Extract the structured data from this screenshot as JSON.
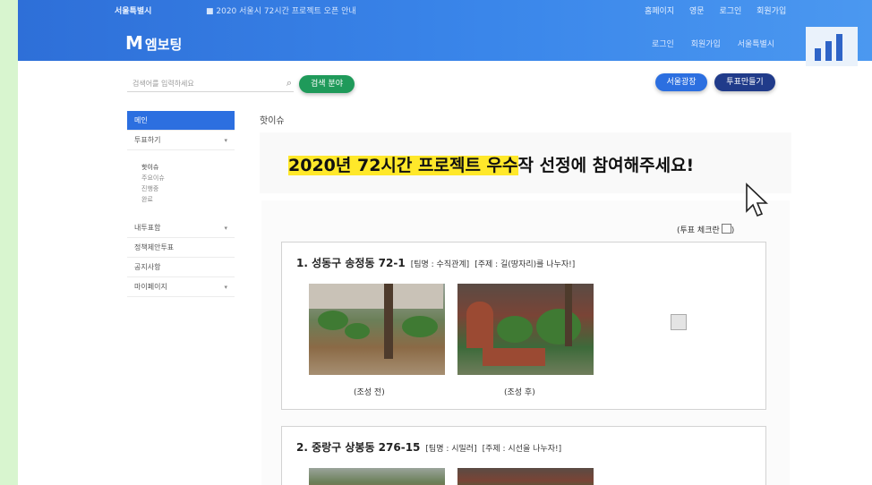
{
  "topbar": {
    "org": "서울특별시",
    "notice": "■ 2020 서울시 72시간 프로젝트 오픈 안내",
    "links": [
      "홈페이지",
      "영문",
      "로그인",
      "회원가입"
    ]
  },
  "header": {
    "logo_letter": "M",
    "logo_text": "엠보팅",
    "links": [
      "로그인",
      "회원가입",
      "서울특별시"
    ]
  },
  "search": {
    "placeholder": "검색어를 입력하세요",
    "category_button": "검색 분야",
    "button_a": "서울광장",
    "button_b": "투표만들기"
  },
  "sidebar": {
    "items": [
      {
        "label": "메인",
        "active": true
      },
      {
        "label": "투표하기",
        "arrow": "▾"
      },
      {
        "label": "내투표함",
        "arrow": "▾"
      },
      {
        "label": "정책제안투표"
      },
      {
        "label": "공지사항"
      },
      {
        "label": "마이페이지",
        "arrow": "▾"
      }
    ],
    "subitems": [
      "핫이슈",
      "주요이슈",
      "진행중",
      "완료"
    ]
  },
  "main": {
    "breadcrumb": "핫이슈",
    "banner_highlight_1": "2020년 72시간 ",
    "banner_mid": "프로젝트 ",
    "banner_highlight_2": "우수",
    "banner_rest": "작 선정에 참여해주세요!",
    "vote_label": "(투표 체크란",
    "vote_label_end": ")"
  },
  "entries": [
    {
      "title": "1. 성동구 송정동 72-1",
      "team": "[팀명 : 수직관계]",
      "theme": "[주제 : 길(땅자리)를 나누자!]",
      "caption_before": "(조성 전)",
      "caption_after": "(조성 후)"
    },
    {
      "title": "2. 중랑구 상봉동 276-15",
      "team": "[팀명 : 시밀러]",
      "theme": "[주제 : 시선을 나누자!]"
    }
  ],
  "colors": {
    "header_blue": "#3a86ea",
    "active_blue": "#2c6fe0",
    "navy": "#203b8a",
    "green": "#1f9a5a",
    "highlight": "#ffe82a",
    "outer_bg": "#d8f5cf"
  }
}
